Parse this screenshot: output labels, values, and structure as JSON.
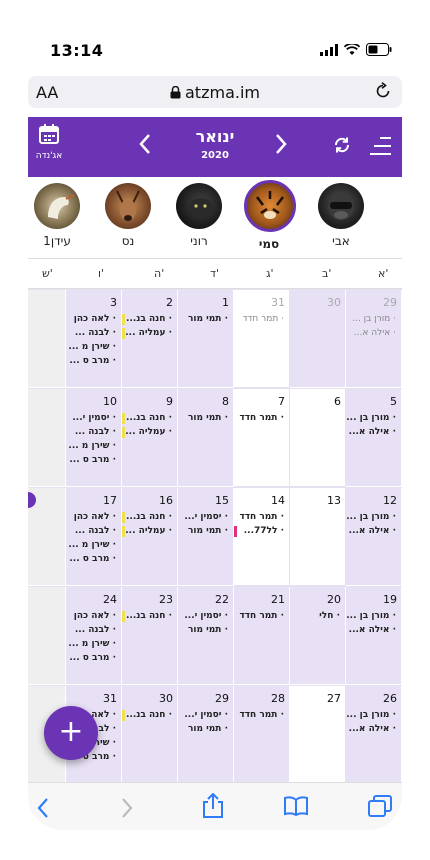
{
  "status": {
    "time": "13:14"
  },
  "browser": {
    "text_size": "AA",
    "url": "atzma.im"
  },
  "header": {
    "agenda_label": "אג'נדה",
    "month": "ינואר",
    "year": "2020"
  },
  "avatars": [
    {
      "name": "אבי",
      "selected": false,
      "color": "#3a3a3a"
    },
    {
      "name": "סמי",
      "selected": true,
      "color": "#b86a22"
    },
    {
      "name": "רוני",
      "selected": false,
      "color": "#222222"
    },
    {
      "name": "נס",
      "selected": false,
      "color": "#9a6a44"
    },
    {
      "name": "עידן1",
      "selected": false,
      "color": "#8a6a4a"
    }
  ],
  "weekdays": [
    "א'",
    "ב'",
    "ג'",
    "ד'",
    "ה'",
    "ו'",
    "ש'"
  ],
  "weeks": [
    [
      {
        "num": "29",
        "other": true,
        "events": [
          "· מורן בן ...",
          "· אילה א..."
        ]
      },
      {
        "num": "30",
        "other": true,
        "events": []
      },
      {
        "num": "31",
        "other": true,
        "events": [
          "· תמר חדד"
        ],
        "white": true
      },
      {
        "num": "1",
        "events": [
          "· תמי מור"
        ]
      },
      {
        "num": "2",
        "events": [
          "· חנה בנ...",
          "· עמליה ..."
        ],
        "bars": [
          "#f1e04a",
          "#f1e04a"
        ]
      },
      {
        "num": "3",
        "events": [
          "· לאה כהן",
          "· לבנה ...",
          "· שירן מ ...",
          "· מרב ס ..."
        ]
      },
      {
        "num": "",
        "gray": true,
        "events": []
      }
    ],
    [
      {
        "num": "5",
        "events": [
          "· מורן בן ...",
          "· אילה א..."
        ]
      },
      {
        "num": "6",
        "white": true,
        "events": []
      },
      {
        "num": "7",
        "white": true,
        "events": [
          "· תמר חדד"
        ]
      },
      {
        "num": "8",
        "events": [
          "· תמי מור"
        ]
      },
      {
        "num": "9",
        "events": [
          "· חנה בנ...",
          "· עמליה ..."
        ],
        "bars": [
          "#f1e04a",
          "#f1e04a"
        ]
      },
      {
        "num": "10",
        "events": [
          "· יסמין י...",
          "· לבנה ...",
          "· שירן מ ...",
          "· מרב ס ..."
        ]
      },
      {
        "num": "",
        "gray": true,
        "events": []
      }
    ],
    [
      {
        "num": "12",
        "events": [
          "· מורן בן ...",
          "· אילה א..."
        ]
      },
      {
        "num": "13",
        "white": true,
        "events": []
      },
      {
        "num": "14",
        "white": true,
        "events": [
          "· תמר חדד",
          "· לל77..."
        ],
        "bars": [
          "",
          "#e0307a"
        ]
      },
      {
        "num": "15",
        "events": [
          "· יסמין י...",
          "· תמי מור"
        ]
      },
      {
        "num": "16",
        "events": [
          "· חנה בנ...",
          "· עמליה ..."
        ],
        "bars": [
          "#f1e04a",
          "#f1e04a"
        ]
      },
      {
        "num": "17",
        "events": [
          "· לאה כהן",
          "· לבנה ...",
          "· שירן מ ...",
          "· מרב ס ..."
        ]
      },
      {
        "num": "",
        "gray": true,
        "events": []
      }
    ],
    [
      {
        "num": "19",
        "events": [
          "· מורן בן ...",
          "· אילה א..."
        ]
      },
      {
        "num": "20",
        "events": [
          "· חלי"
        ]
      },
      {
        "num": "21",
        "events": [
          "· תמר חדד"
        ]
      },
      {
        "num": "22",
        "events": [
          "· יסמין י...",
          "· תמי מור"
        ]
      },
      {
        "num": "23",
        "events": [
          "· חנה בנ..."
        ],
        "bars": [
          "#f1e04a"
        ]
      },
      {
        "num": "24",
        "events": [
          "· לאה כהן",
          "· לבנה ...",
          "· שירן מ ...",
          "· מרב ס ..."
        ]
      },
      {
        "num": "",
        "gray": true,
        "events": []
      }
    ],
    [
      {
        "num": "26",
        "events": [
          "· מורן בן ...",
          "· אילה א..."
        ]
      },
      {
        "num": "27",
        "white": true,
        "events": []
      },
      {
        "num": "28",
        "events": [
          "· תמר חדד"
        ]
      },
      {
        "num": "29",
        "events": [
          "· יסמין י...",
          "· תמי מור"
        ]
      },
      {
        "num": "30",
        "events": [
          "· חנה בנ..."
        ],
        "bars": [
          "#f1e04a"
        ]
      },
      {
        "num": "31",
        "events": [
          "· לאה כהן",
          "· לבנה ...",
          "· שירן מ ...",
          "· מרב ס ..."
        ]
      },
      {
        "num": "",
        "gray": true,
        "events": []
      }
    ]
  ],
  "fab": {
    "label": "+"
  },
  "colors": {
    "accent": "#6a34b5",
    "event_bg": "#e8e0f4"
  }
}
